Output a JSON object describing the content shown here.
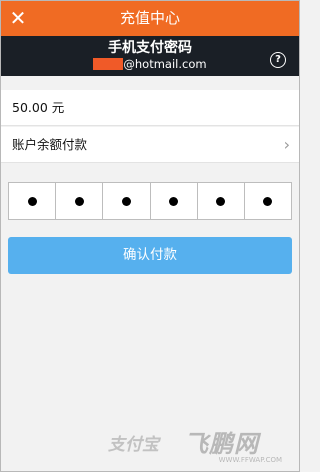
{
  "header": {
    "title": "充值中心",
    "close_glyph": "✕"
  },
  "password": {
    "title": "手机支付密码",
    "account_suffix": "@hotmail.com",
    "help_glyph": "?"
  },
  "amount": {
    "text": "50.00 元"
  },
  "method": {
    "label": "账户余额付款"
  },
  "pin": {
    "digit_count": 6,
    "filled": 6
  },
  "confirm": {
    "label": "确认付款"
  },
  "watermark": {
    "alipay": "支付宝",
    "site_logo": "飞鹏网",
    "site_url": "WWW.FFWAP.COM"
  },
  "colors": {
    "header": "#f06b23",
    "dark_band": "#1a1f26",
    "confirm_button": "#56b0ee",
    "redaction": "#f05a28"
  }
}
